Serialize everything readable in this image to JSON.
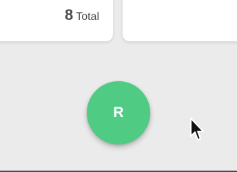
{
  "summary": {
    "total_count": "8",
    "total_label": "Total"
  },
  "fab": {
    "letter": "R"
  },
  "colors": {
    "background": "#ebebeb",
    "card": "#ffffff",
    "fab": "#4fcb83",
    "text": "#4a4a4a"
  }
}
